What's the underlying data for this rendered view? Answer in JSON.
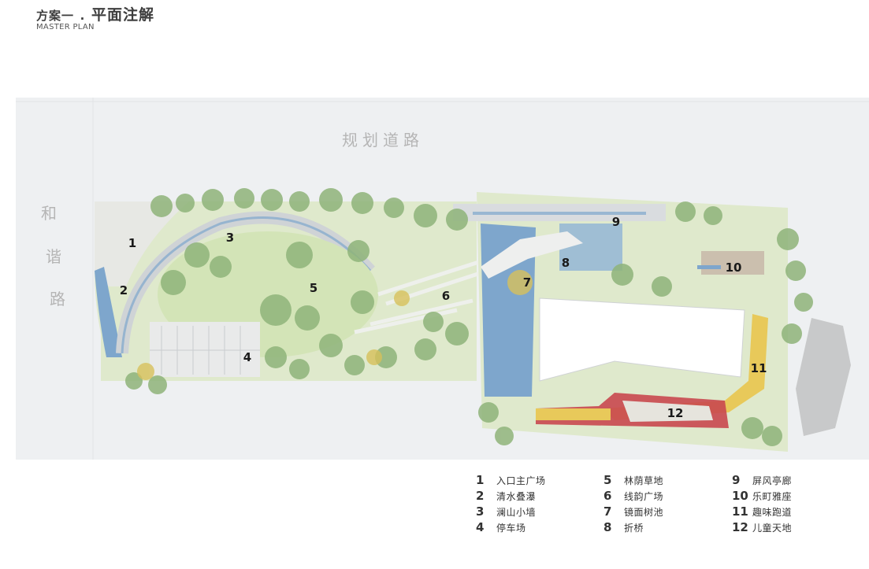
{
  "header": {
    "title_prefix": "方案一",
    "title_sep": ".",
    "title_main": "平面注解",
    "subtitle": "MASTER PLAN"
  },
  "roads": {
    "top": "规划道路",
    "left_chars": [
      "和",
      "谐",
      "路"
    ]
  },
  "markers": [
    "1",
    "2",
    "3",
    "4",
    "5",
    "6",
    "7",
    "8",
    "9",
    "10",
    "11",
    "12"
  ],
  "legend": [
    {
      "num": "1",
      "label": "入口主广场"
    },
    {
      "num": "2",
      "label": "清水叠瀑"
    },
    {
      "num": "3",
      "label": "澜山小墙"
    },
    {
      "num": "4",
      "label": "停车场"
    },
    {
      "num": "5",
      "label": "林荫草地"
    },
    {
      "num": "6",
      "label": "线韵广场"
    },
    {
      "num": "7",
      "label": "镜面树池"
    },
    {
      "num": "8",
      "label": "折桥"
    },
    {
      "num": "9",
      "label": "屏风亭廊"
    },
    {
      "num": "10",
      "label": "乐町雅座"
    },
    {
      "num": "11",
      "label": "趣味跑道"
    },
    {
      "num": "12",
      "label": "儿童天地"
    }
  ],
  "colors": {
    "road": "#eef0f2",
    "lawn": "#dbe8c5",
    "tree": "#8fb47a",
    "water": "#7ea6cc",
    "building": "#ffffff",
    "track": "#e8c95a",
    "kids_red": "#c9484f"
  }
}
